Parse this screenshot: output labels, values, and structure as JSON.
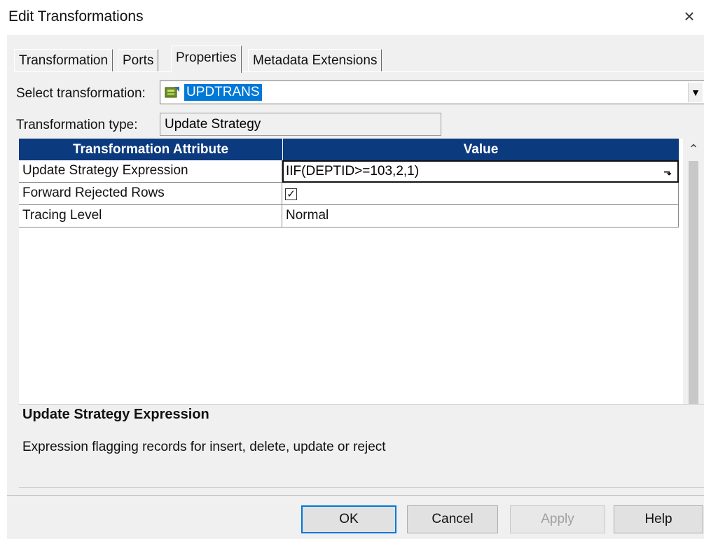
{
  "window": {
    "title": "Edit Transformations",
    "close_glyph": "×"
  },
  "tabs": [
    {
      "label": "Transformation",
      "active": false
    },
    {
      "label": "Ports",
      "active": false
    },
    {
      "label": "Properties",
      "active": true
    },
    {
      "label": "Metadata Extensions",
      "active": false
    }
  ],
  "select_transformation": {
    "label": "Select transformation:",
    "value": "UPDTRANS",
    "icon": "update-strategy-icon"
  },
  "transformation_type": {
    "label": "Transformation type:",
    "value": "Update Strategy"
  },
  "grid": {
    "headers": [
      "Transformation Attribute",
      "Value"
    ],
    "rows": [
      {
        "attribute": "Update Strategy Expression",
        "value": "IIF(DEPTID>=103,2,1)"
      },
      {
        "attribute": "Forward Rejected Rows",
        "value": "",
        "checked": true
      },
      {
        "attribute": "Tracing Level",
        "value": "Normal"
      }
    ]
  },
  "description": {
    "title": "Update Strategy Expression",
    "text": "Expression flagging records for insert, delete, update or reject"
  },
  "buttons": {
    "ok": "OK",
    "cancel": "Cancel",
    "apply": "Apply",
    "help": "Help"
  },
  "colors": {
    "grid_header": "#0b3a7e",
    "selection": "#0078d7"
  }
}
